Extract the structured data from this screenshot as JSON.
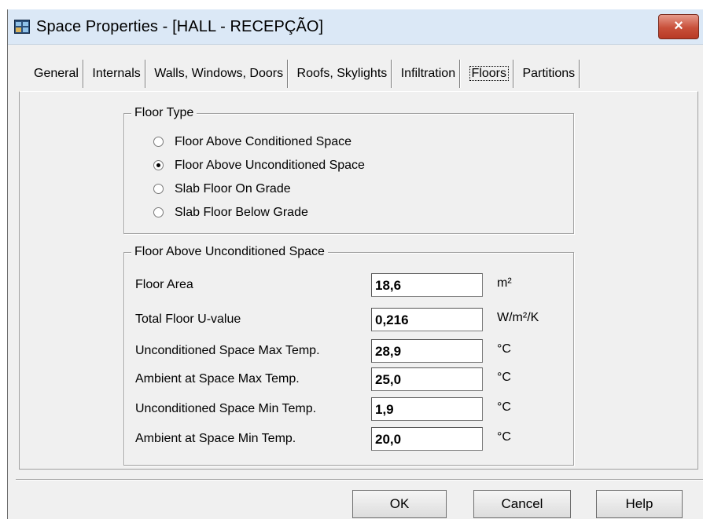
{
  "window": {
    "title": "Space Properties - [HALL - RECEPÇÃO]",
    "close_label": "×"
  },
  "tabs": [
    {
      "label": "General",
      "active": false
    },
    {
      "label": "Internals",
      "active": false
    },
    {
      "label": "Walls, Windows, Doors",
      "active": false
    },
    {
      "label": "Roofs, Skylights",
      "active": false
    },
    {
      "label": "Infiltration",
      "active": false
    },
    {
      "label": "Floors",
      "active": true
    },
    {
      "label": "Partitions",
      "active": false
    }
  ],
  "floor_type": {
    "title": "Floor Type",
    "options": [
      {
        "label": "Floor Above Conditioned Space",
        "checked": false
      },
      {
        "label": "Floor Above Unconditioned Space",
        "checked": true
      },
      {
        "label": "Slab Floor On Grade",
        "checked": false
      },
      {
        "label": "Slab Floor Below Grade",
        "checked": false
      }
    ]
  },
  "unconditioned": {
    "title": "Floor Above Unconditioned Space",
    "fields": [
      {
        "label": "Floor Area",
        "value": "18,6",
        "unit": "m²"
      },
      {
        "label": "Total Floor U-value",
        "value": "0,216",
        "unit": "W/m²/K"
      },
      {
        "label": "Unconditioned Space Max Temp.",
        "value": "28,9",
        "unit": "°C"
      },
      {
        "label": "Ambient at Space Max Temp.",
        "value": "25,0",
        "unit": "°C"
      },
      {
        "label": "Unconditioned Space Min Temp.",
        "value": "1,9",
        "unit": "°C"
      },
      {
        "label": "Ambient at Space Min Temp.",
        "value": "20,0",
        "unit": "°C"
      }
    ]
  },
  "buttons": {
    "ok": "OK",
    "cancel": "Cancel",
    "help": "Help"
  },
  "colors": {
    "titlebar": "#dbe8f6",
    "close": "#c8503a",
    "window": "#f0f0f0"
  }
}
